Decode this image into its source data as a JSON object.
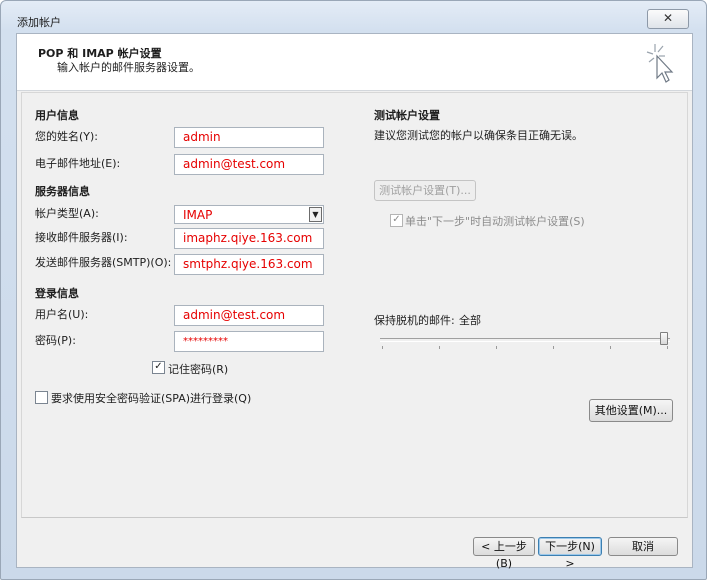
{
  "window": {
    "title": "添加帐户",
    "close_glyph": "✕"
  },
  "header": {
    "title": "POP 和 IMAP 帐户设置",
    "subtitle": "输入帐户的邮件服务器设置。"
  },
  "user_info": {
    "heading": "用户信息",
    "name_label": "您的姓名(Y):",
    "name_value": "admin",
    "email_label": "电子邮件地址(E):",
    "email_value": "admin@test.com"
  },
  "server_info": {
    "heading": "服务器信息",
    "account_type_label": "帐户类型(A):",
    "account_type_value": "IMAP",
    "incoming_label": "接收邮件服务器(I):",
    "incoming_value": "imaphz.qiye.163.com",
    "outgoing_label": "发送邮件服务器(SMTP)(O):",
    "outgoing_value": "smtphz.qiye.163.com"
  },
  "login_info": {
    "heading": "登录信息",
    "username_label": "用户名(U):",
    "username_value": "admin@test.com",
    "password_label": "密码(P):",
    "password_value": "*********",
    "remember_label": "记住密码(R)",
    "remember_checked": true
  },
  "spa": {
    "label": "要求使用安全密码验证(SPA)进行登录(Q)",
    "checked": false
  },
  "test": {
    "heading": "测试帐户设置",
    "description": "建议您测试您的帐户以确保条目正确无误。",
    "button_label": "测试帐户设置(T)...",
    "auto_test_label": "单击\"下一步\"时自动测试帐户设置(S)",
    "auto_test_checked": true
  },
  "offline": {
    "label": "保持脱机的邮件:",
    "value": "全部",
    "slider_position_fraction": 1.0
  },
  "more_settings_label": "其他设置(M)...",
  "nav": {
    "back_label": "< 上一步(B)",
    "next_label": "下一步(N) >",
    "cancel_label": "取消"
  }
}
